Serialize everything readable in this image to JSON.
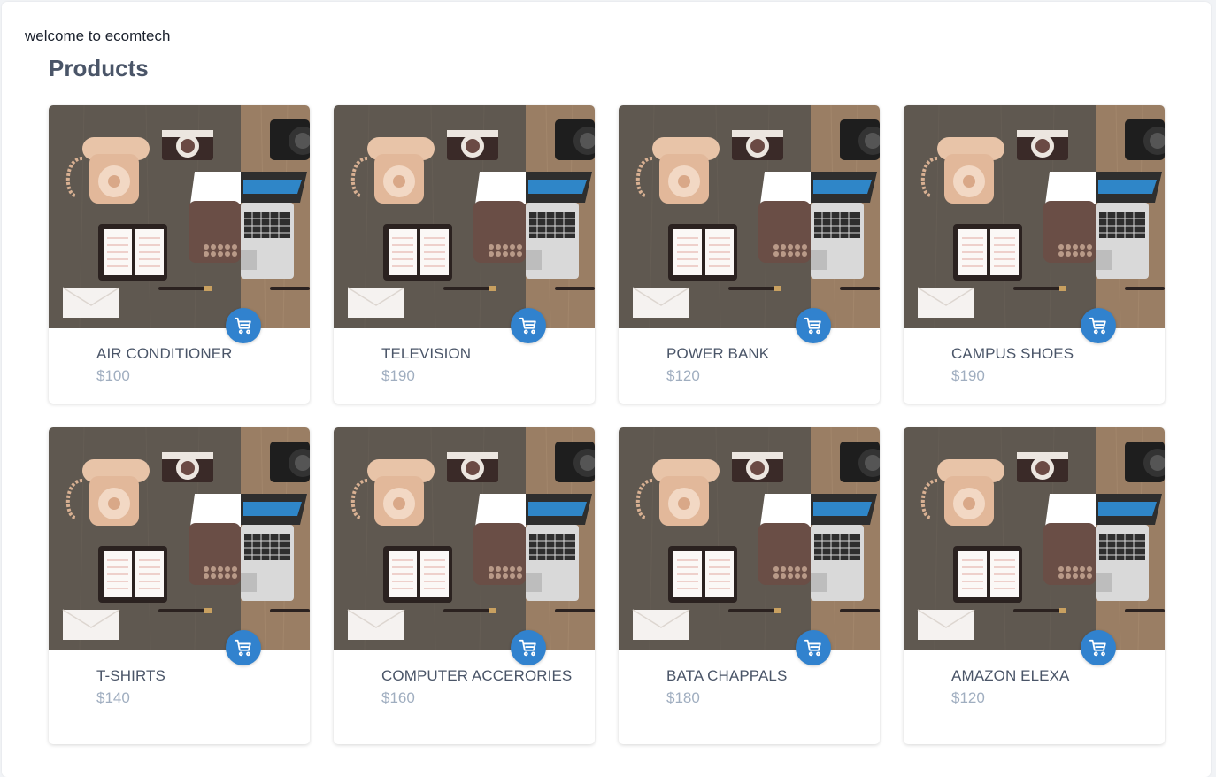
{
  "page": {
    "welcome": "welcome to ecomtech",
    "title": "Products"
  },
  "products": [
    {
      "name": "AIR CONDITIONER",
      "price": "$100"
    },
    {
      "name": "TELEVISION",
      "price": "$190"
    },
    {
      "name": "POWER BANK",
      "price": "$120"
    },
    {
      "name": "CAMPUS SHOES",
      "price": "$190"
    },
    {
      "name": "T-SHIRTS",
      "price": "$140"
    },
    {
      "name": "COMPUTER ACCERORIES",
      "price": "$160"
    },
    {
      "name": "BATA CHAPPALS",
      "price": "$180"
    },
    {
      "name": "AMAZON ELEXA",
      "price": "$120"
    }
  ],
  "icons": {
    "cart": "shopping-cart-icon"
  },
  "colors": {
    "accent": "#3182ce",
    "price": "#a0aec0",
    "name": "#4a5568"
  }
}
